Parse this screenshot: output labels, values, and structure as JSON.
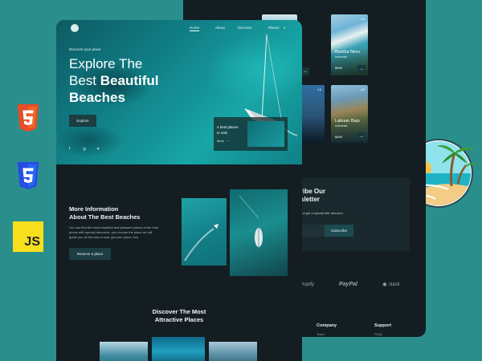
{
  "tech_icons": [
    {
      "name": "html5-icon",
      "label": "5",
      "color": "#e44d26"
    },
    {
      "name": "css3-icon",
      "label": "3",
      "color": "#264de4"
    },
    {
      "name": "js-icon",
      "label": "JS",
      "color": "#f7df1e"
    }
  ],
  "destinations": {
    "cards": [
      {
        "name": "Bamba Neru",
        "place": "Indonesia",
        "price": "$599",
        "rating": "4.8"
      },
      {
        "name": "Labuan Bajo",
        "place": "Indonesia",
        "price": "$499",
        "rating": "4.8"
      }
    ]
  },
  "newsletter": {
    "title_line1": "ribe Our",
    "title_line2": "sletter",
    "description": "and get a special title discount.",
    "button": "Subscribe"
  },
  "sponsors": [
    "shopify",
    "PayPal",
    "slack"
  ],
  "footer": {
    "company": "Company",
    "support": "Support",
    "company_link": "Team",
    "support_link": "FAQs"
  },
  "nav": {
    "items": [
      "Home",
      "About",
      "Discover",
      "Places"
    ]
  },
  "hero": {
    "eyebrow": "Discover your place",
    "title_line1": "Explore The",
    "title_line2_plain": "Best",
    "title_line2_bold": "Beautiful",
    "title_line3": "Beaches",
    "button": "Explore",
    "card_text_line1": "4 best places",
    "card_text_line2": "to visit",
    "card_link": "More"
  },
  "about": {
    "title_line1": "More Information",
    "title_line2": "About The Best Beaches",
    "paragraph": [
      "You can find the most beautiful and pleasant places at the best",
      "prices with special discounts, you choose the place we will",
      "guide you all the way to wait, get your place now."
    ],
    "button": "Reserve a place"
  },
  "discover": {
    "title_line1": "Discover The Most",
    "title_line2": "Attractive Places"
  }
}
